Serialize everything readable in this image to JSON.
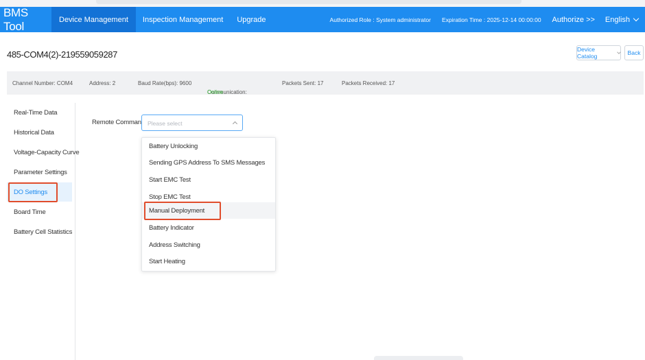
{
  "header": {
    "logo": "BMS Tool",
    "nav": [
      {
        "label": "Device Management"
      },
      {
        "label": "Inspection Management"
      },
      {
        "label": "Upgrade"
      }
    ],
    "authorized_role": "Authorized Role : System administrator",
    "expiration_time": "Expiration Time : 2025-12-14 00:00:00",
    "authorize_label": "Authorize >>",
    "language": "English"
  },
  "device": {
    "title": "485-COM4(2)-219559059287",
    "catalog_label": "Device Catalog",
    "back_label": "Back"
  },
  "info": {
    "channel": "Channel Number: COM4",
    "address": "Address: 2",
    "baud_rate": "Baud Rate(bps): 9600",
    "communication_label": "Communication:",
    "communication_value": "Online",
    "packets_sent": "Packets Sent: 17",
    "packets_received": "Packets Received: 17"
  },
  "sidebar": {
    "items": [
      {
        "label": "Real-Time Data"
      },
      {
        "label": "Historical Data"
      },
      {
        "label": "Voltage-Capacity Curve"
      },
      {
        "label": "Parameter Settings"
      },
      {
        "label": "DO Settings"
      },
      {
        "label": "Board Time"
      },
      {
        "label": "Battery Cell Statistics"
      }
    ]
  },
  "remote": {
    "label": "Remote Commands",
    "placeholder": "Please select",
    "options": [
      {
        "label": "Battery Unlocking"
      },
      {
        "label": "Sending GPS Address To SMS Messages"
      },
      {
        "label": "Start EMC Test"
      },
      {
        "label": "Stop EMC Test"
      },
      {
        "label": "Manual Deployment"
      },
      {
        "label": "Battery Indicator"
      },
      {
        "label": "Address Switching"
      },
      {
        "label": "Start Heating"
      }
    ]
  },
  "colors": {
    "primary": "#1e8cf0",
    "nav_active": "#1372d6",
    "online": "#33b333",
    "highlight": "#e04c2b",
    "sidebar_active_bg": "#e6f2fd"
  }
}
